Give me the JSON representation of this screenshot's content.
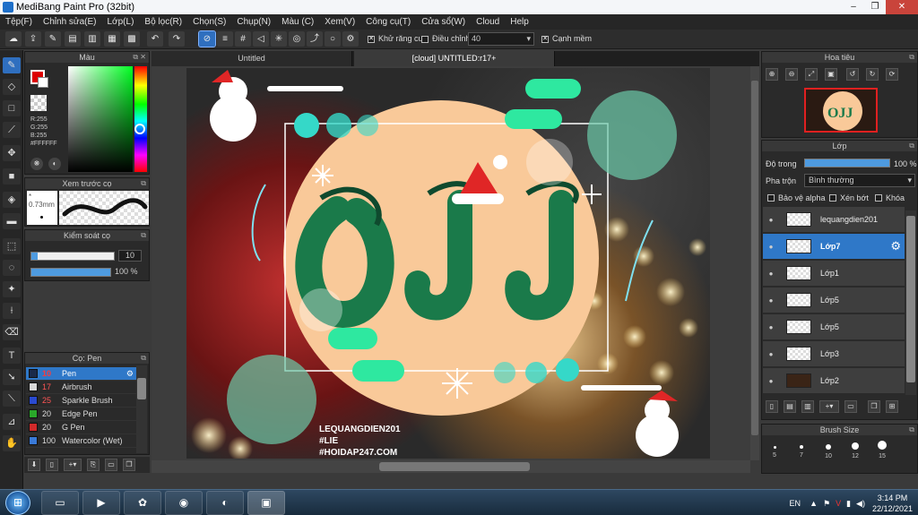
{
  "window": {
    "title": "MediBang Paint Pro (32bit)",
    "min_icon": "minimize-icon",
    "max_icon": "maximize-icon",
    "close_icon": "close-icon"
  },
  "menu": [
    "Tệp(F)",
    "Chỉnh sửa(E)",
    "Lớp(L)",
    "Bộ lọc(R)",
    "Chọn(S)",
    "Chụp(N)",
    "Màu (C)",
    "Xem(V)",
    "Công cụ(T)",
    "Cửa sổ(W)",
    "Cloud",
    "Help"
  ],
  "toolbar": {
    "antialias_label": "Khử răng cưa",
    "correction_label": "Điều chỉnh",
    "correction_value": "40",
    "smooth_label": "Cạnh mềm"
  },
  "color_panel": {
    "title": "Màu",
    "r": "R:255",
    "g": "G:255",
    "b": "B:255",
    "hex": "#FFFFFF",
    "fg_color": "#dd0000",
    "bg_color": "#ffffff"
  },
  "brush_preview": {
    "title": "Xem trước cọ",
    "size": "0.73mm"
  },
  "brush_control": {
    "title": "Kiểm soát cọ",
    "size_value": "10",
    "opacity_value": "100 %",
    "size_fraction": 0.08,
    "opacity_fraction": 1.0
  },
  "brush_list": {
    "title": "Cọ: Pen",
    "items": [
      {
        "num": "10",
        "name": "Pen",
        "color": "#1a2a4a"
      },
      {
        "num": "17",
        "name": "Airbrush",
        "color": "#d8d8d8"
      },
      {
        "num": "25",
        "name": "Sparkle Brush",
        "color": "#2a4ad0"
      },
      {
        "num": "20",
        "name": "Edge Pen",
        "color": "#2aa82a"
      },
      {
        "num": "20",
        "name": "G Pen",
        "color": "#d02a2a"
      },
      {
        "num": "100",
        "name": "Watercolor (Wet)",
        "color": "#3a7ad8"
      }
    ]
  },
  "tabs": [
    {
      "label": "Untitled"
    },
    {
      "label": "[cloud] UNTITLED:r17+"
    }
  ],
  "artwork": {
    "signature_1": "LEQUANGDIEN201",
    "signature_2": "#LIE",
    "signature_3": "#HOIDAP247.COM"
  },
  "navigator": {
    "title": "Hoa tiêu"
  },
  "layers": {
    "title": "Lớp",
    "opacity_label": "Độ trong",
    "opacity_value": "100 %",
    "opacity_fraction": 1.0,
    "blend_label": "Pha trộn",
    "blend_value": "Bình thường",
    "protect_alpha": "Bảo vệ alpha",
    "clipping": "Xén bớt",
    "lock": "Khóa",
    "items": [
      {
        "name": "lequangdien201",
        "selected": false
      },
      {
        "name": "Lớp7",
        "selected": true
      },
      {
        "name": "Lớp1",
        "selected": false
      },
      {
        "name": "Lớp5",
        "selected": false
      },
      {
        "name": "Lớp5",
        "selected": false
      },
      {
        "name": "Lớp3",
        "selected": false
      },
      {
        "name": "Lớp2",
        "selected": false
      }
    ]
  },
  "brush_size": {
    "title": "Brush Size",
    "sizes": [
      "5",
      "7",
      "10",
      "12",
      "15"
    ]
  },
  "taskbar": {
    "lang": "EN",
    "time": "3:14 PM",
    "date": "22/12/2021"
  }
}
